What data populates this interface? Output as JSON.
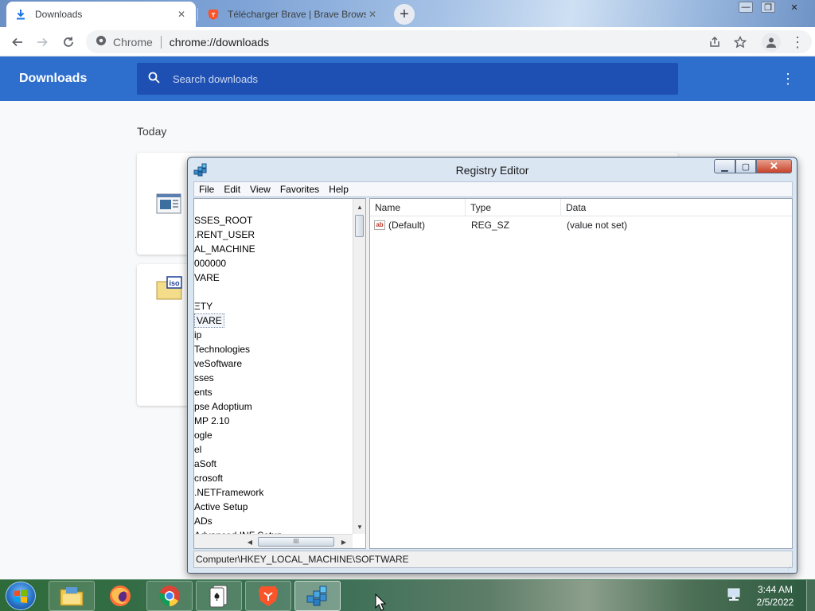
{
  "browser": {
    "tabs": [
      {
        "title": "Downloads",
        "active": true,
        "icon": "download-icon"
      },
      {
        "title": "Télécharger Brave | Brave Browse",
        "active": false,
        "icon": "brave-icon"
      }
    ],
    "new_tab": "+",
    "omnibox": {
      "site_label": "Chrome",
      "url": "chrome://downloads"
    }
  },
  "downloads_page": {
    "title": "Downloads",
    "search_placeholder": "Search downloads",
    "date_label": "Today",
    "items": [
      {
        "icon": "executable-file-icon"
      },
      {
        "icon": "iso-file-icon",
        "badge": "iso"
      }
    ]
  },
  "regedit": {
    "title": "Registry Editor",
    "menu": [
      "File",
      "Edit",
      "View",
      "Favorites",
      "Help"
    ],
    "tree_items": [
      "SSES_ROOT",
      ".RENT_USER",
      "AL_MACHINE",
      "000000",
      "VARE",
      "",
      "ΞTY",
      "VARE",
      "ip",
      " Technologies",
      "veSoftware",
      "sses",
      "ents",
      "pse Adoptium",
      "MP 2.10",
      "ogle",
      "el",
      "aSoft",
      "crosoft",
      ".NETFramework",
      " Active Setup",
      "ADs",
      "Advanced INF Setup"
    ],
    "selected_index": 7,
    "columns": [
      "Name",
      "Type",
      "Data"
    ],
    "values": [
      {
        "name": "(Default)",
        "type": "REG_SZ",
        "data": "(value not set)"
      }
    ],
    "status_path": "Computer\\HKEY_LOCAL_MACHINE\\SOFTWARE"
  },
  "taskbar": {
    "apps": [
      "explorer-icon",
      "firefox-icon",
      "chrome-icon",
      "solitaire-icon",
      "brave-icon",
      "regedit-icon"
    ],
    "time": "3:44 AM",
    "date": "2/5/2022"
  },
  "colors": {
    "downloads_header": "#2e6fcd",
    "search_bg": "#1e4fb3",
    "brave_orange": "#fb542b"
  }
}
